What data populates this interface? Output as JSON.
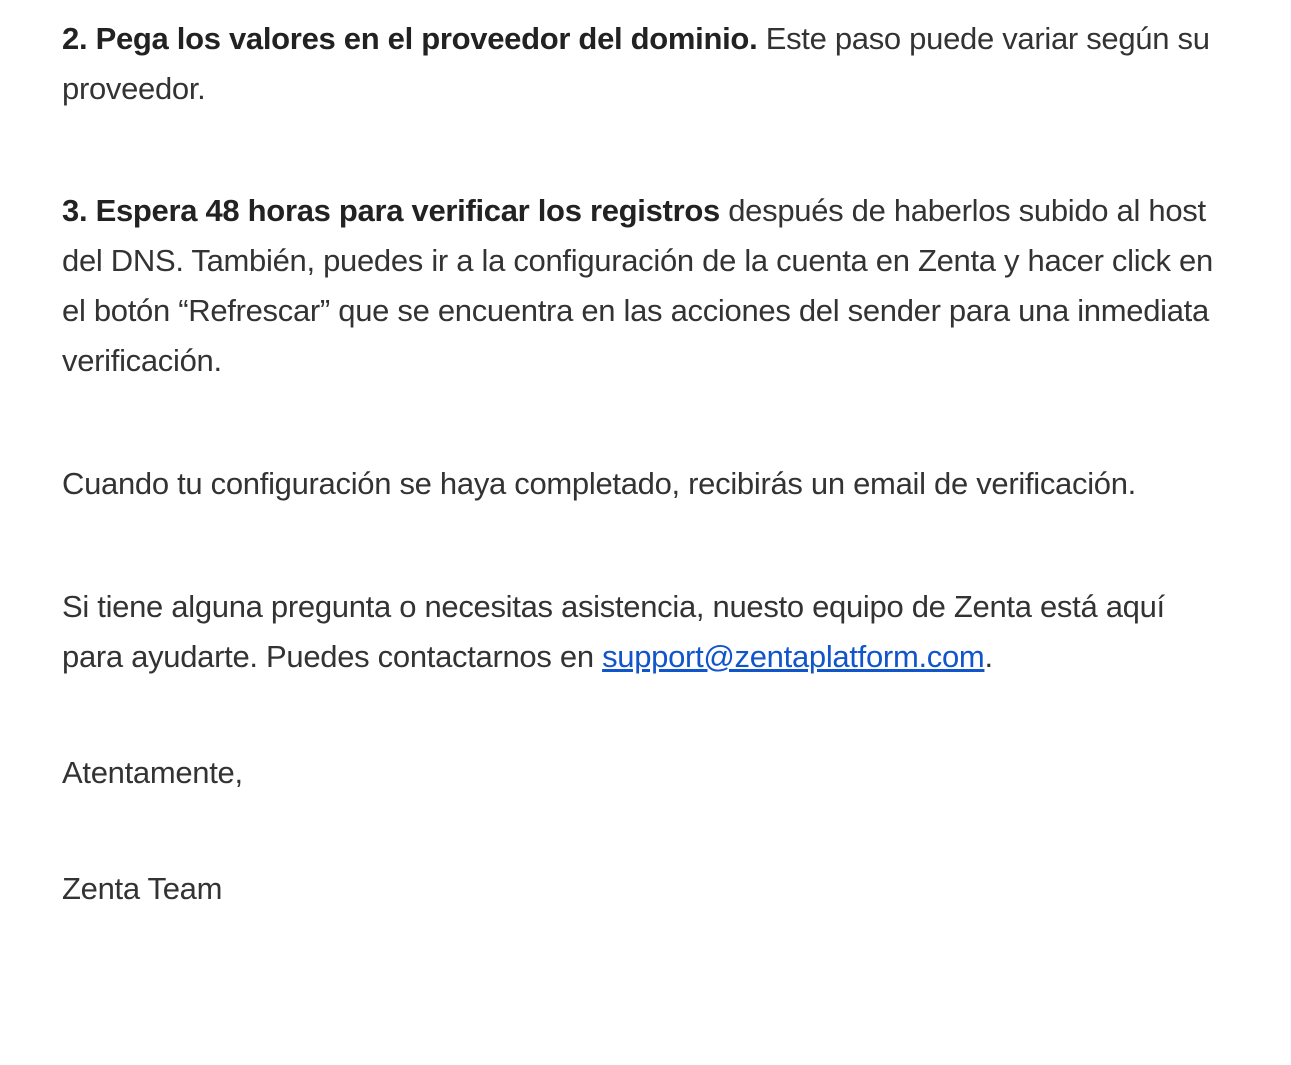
{
  "step2": {
    "bold": "2. Pega los valores en el proveedor del dominio.",
    "text": " Este paso puede variar según su proveedor."
  },
  "step3": {
    "bold": "3. Espera 48 horas para verificar los registros",
    "text": " después de haberlos subido al host del DNS. También, puedes ir a la configuración de la cuenta en Zenta y hacer click en el botón “Refrescar” que se encuentra en las acciones del sender para una inmediata verificación."
  },
  "config_note": "Cuando tu configuración se haya completado, recibirás un email de verificación.",
  "support": {
    "text": "Si tiene alguna pregunta o necesitas asistencia, nuesto equipo de Zenta está aquí para ayudarte. Puedes contactarnos en ",
    "email": "support@zentaplatform.com",
    "period": "."
  },
  "closing": "Atentamente,",
  "signature": "Zenta Team",
  "colors": {
    "text": "#333333",
    "link": "#1155cc"
  }
}
